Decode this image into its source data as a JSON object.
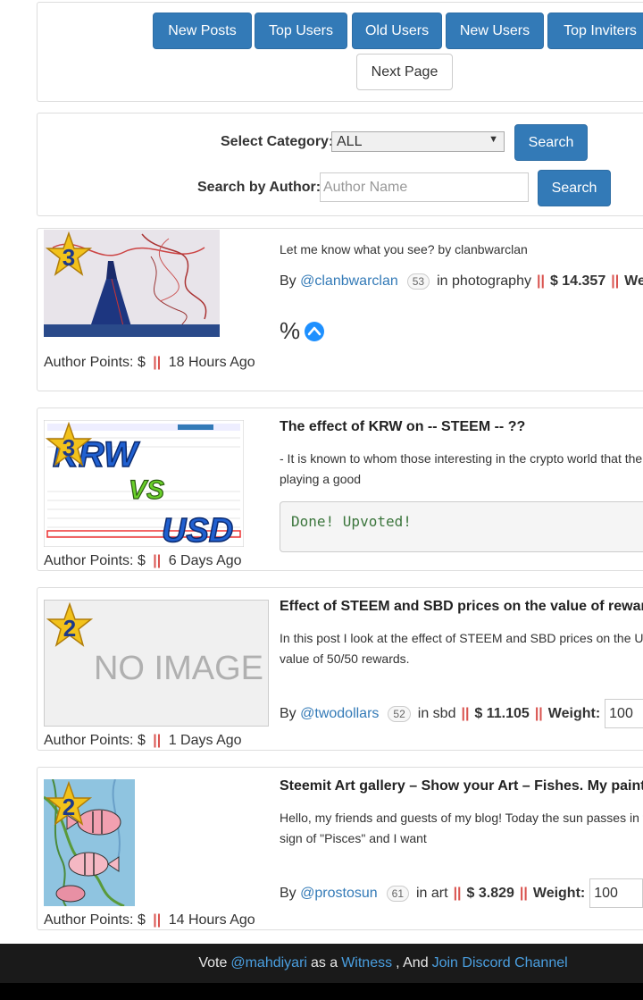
{
  "nav": {
    "buttons": [
      "New Posts",
      "Top Users",
      "Old Users",
      "New Users",
      "Top Inviters"
    ],
    "next_page": "Next Page"
  },
  "search": {
    "category_label": "Select Category:",
    "category_value": "ALL",
    "search_label": "Search",
    "author_label": "Search by Author:",
    "author_placeholder": "Author Name"
  },
  "posts": [
    {
      "title": "",
      "rank": "3",
      "body": "Let me know what you see? by clanbwarclan",
      "author": "@clanbwarclan",
      "rep": "53",
      "category_prefix": "in",
      "category": "photography",
      "payout": "$ 14.357",
      "weight_label": "Weight:",
      "percent": "%",
      "points_label": "Author Points: $",
      "age": "18 Hours Ago"
    },
    {
      "title": "The effect of KRW on -- STEEM -- ??",
      "rank": "3",
      "body": "- It is known to whom those interesting in the crypto world that the playing a good",
      "code": "Done! Upvoted!",
      "points_label": "Author Points: $",
      "age": "6 Days Ago",
      "thumb_words": [
        "KRW",
        "VS",
        "USD"
      ]
    },
    {
      "title": "Effect of STEEM and SBD prices on the value of rewards",
      "rank": "2",
      "body": "In this post I look at the effect of STEEM and SBD prices on the USD value of 50/50 rewards.",
      "author": "@twodollars",
      "rep": "52",
      "category_prefix": "in",
      "category": "sbd",
      "payout": "$ 11.105",
      "weight_label": "Weight:",
      "weight_value": "100",
      "points_label": "Author Points: $",
      "age": "1 Days Ago",
      "no_image": "NO IMAGE"
    },
    {
      "title": "Steemit Art gallery – Show your Art – Fishes. My painting",
      "rank": "2",
      "body": "Hello, my friends and guests of my blog! Today the sun passes in the sign of \"Pisces\" and I want",
      "author": "@prostosun",
      "rep": "61",
      "category_prefix": "in",
      "category": "art",
      "payout": "$ 3.829",
      "weight_label": "Weight:",
      "weight_value": "100",
      "points_label": "Author Points: $",
      "age": "14 Hours Ago"
    }
  ],
  "separator": "||",
  "by_label": "By",
  "footer": {
    "vote": "Vote",
    "user": "@mahdiyari",
    "as_a": "as a",
    "witness": "Witness",
    "and": ", And",
    "discord": "Join Discord Channel"
  },
  "colors": {
    "primary": "#337ab7",
    "separator": "#d9534f",
    "footer_bg": "#1a1a1a"
  }
}
